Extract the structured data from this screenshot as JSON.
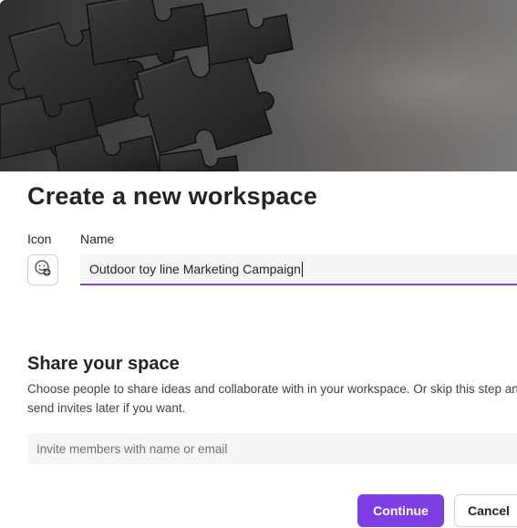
{
  "dialog": {
    "title": "Create a new workspace",
    "icon_label": "Icon",
    "name_label": "Name",
    "icon_button": {
      "icon": "emoji-add-icon"
    },
    "name_value": "Outdoor toy line Marketing Campaign",
    "hero_image": "puzzle-pieces-banner"
  },
  "share": {
    "title": "Share your space",
    "description": "Choose people to share ideas and collaborate with in your workspace. Or skip this step and send invites later if you want.",
    "invite_placeholder": "Invite members with name or email"
  },
  "actions": {
    "continue_label": "Continue",
    "cancel_label": "Cancel"
  },
  "colors": {
    "accent": "#7b3fe4",
    "input_bg": "#f5f5f5",
    "text": "#242424"
  }
}
